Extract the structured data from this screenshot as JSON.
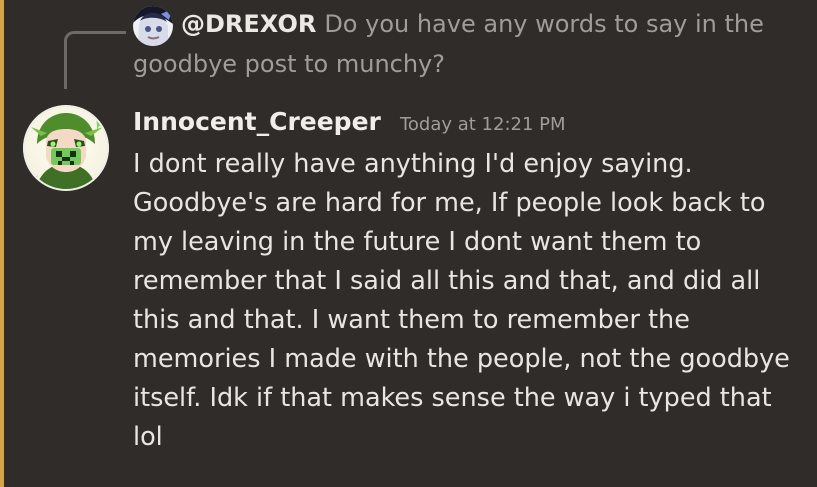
{
  "theme": {
    "background": "#2f2c29",
    "mention_highlight": "#d1a54a",
    "reply_line": "#6f6a66",
    "muted_text": "#a19c98",
    "text": "#e9e6e2"
  },
  "reply": {
    "author": "@DREXOR",
    "content": "Do you have any words to say in the goodbye post to munchy?",
    "avatar_icon": "anime-avatar-icon"
  },
  "message": {
    "author": "Innocent_Creeper",
    "timestamp": "Today at 12:21 PM",
    "avatar_icon": "creeper-avatar-icon",
    "content": "I dont really have anything I'd enjoy saying. Goodbye's are hard for me, If people look back to my leaving in the future I dont want them to remember that I said all this and that, and did all this and that. I want them to remember the memories I made with the people, not the goodbye itself. Idk if that makes sense the way i typed that lol"
  }
}
